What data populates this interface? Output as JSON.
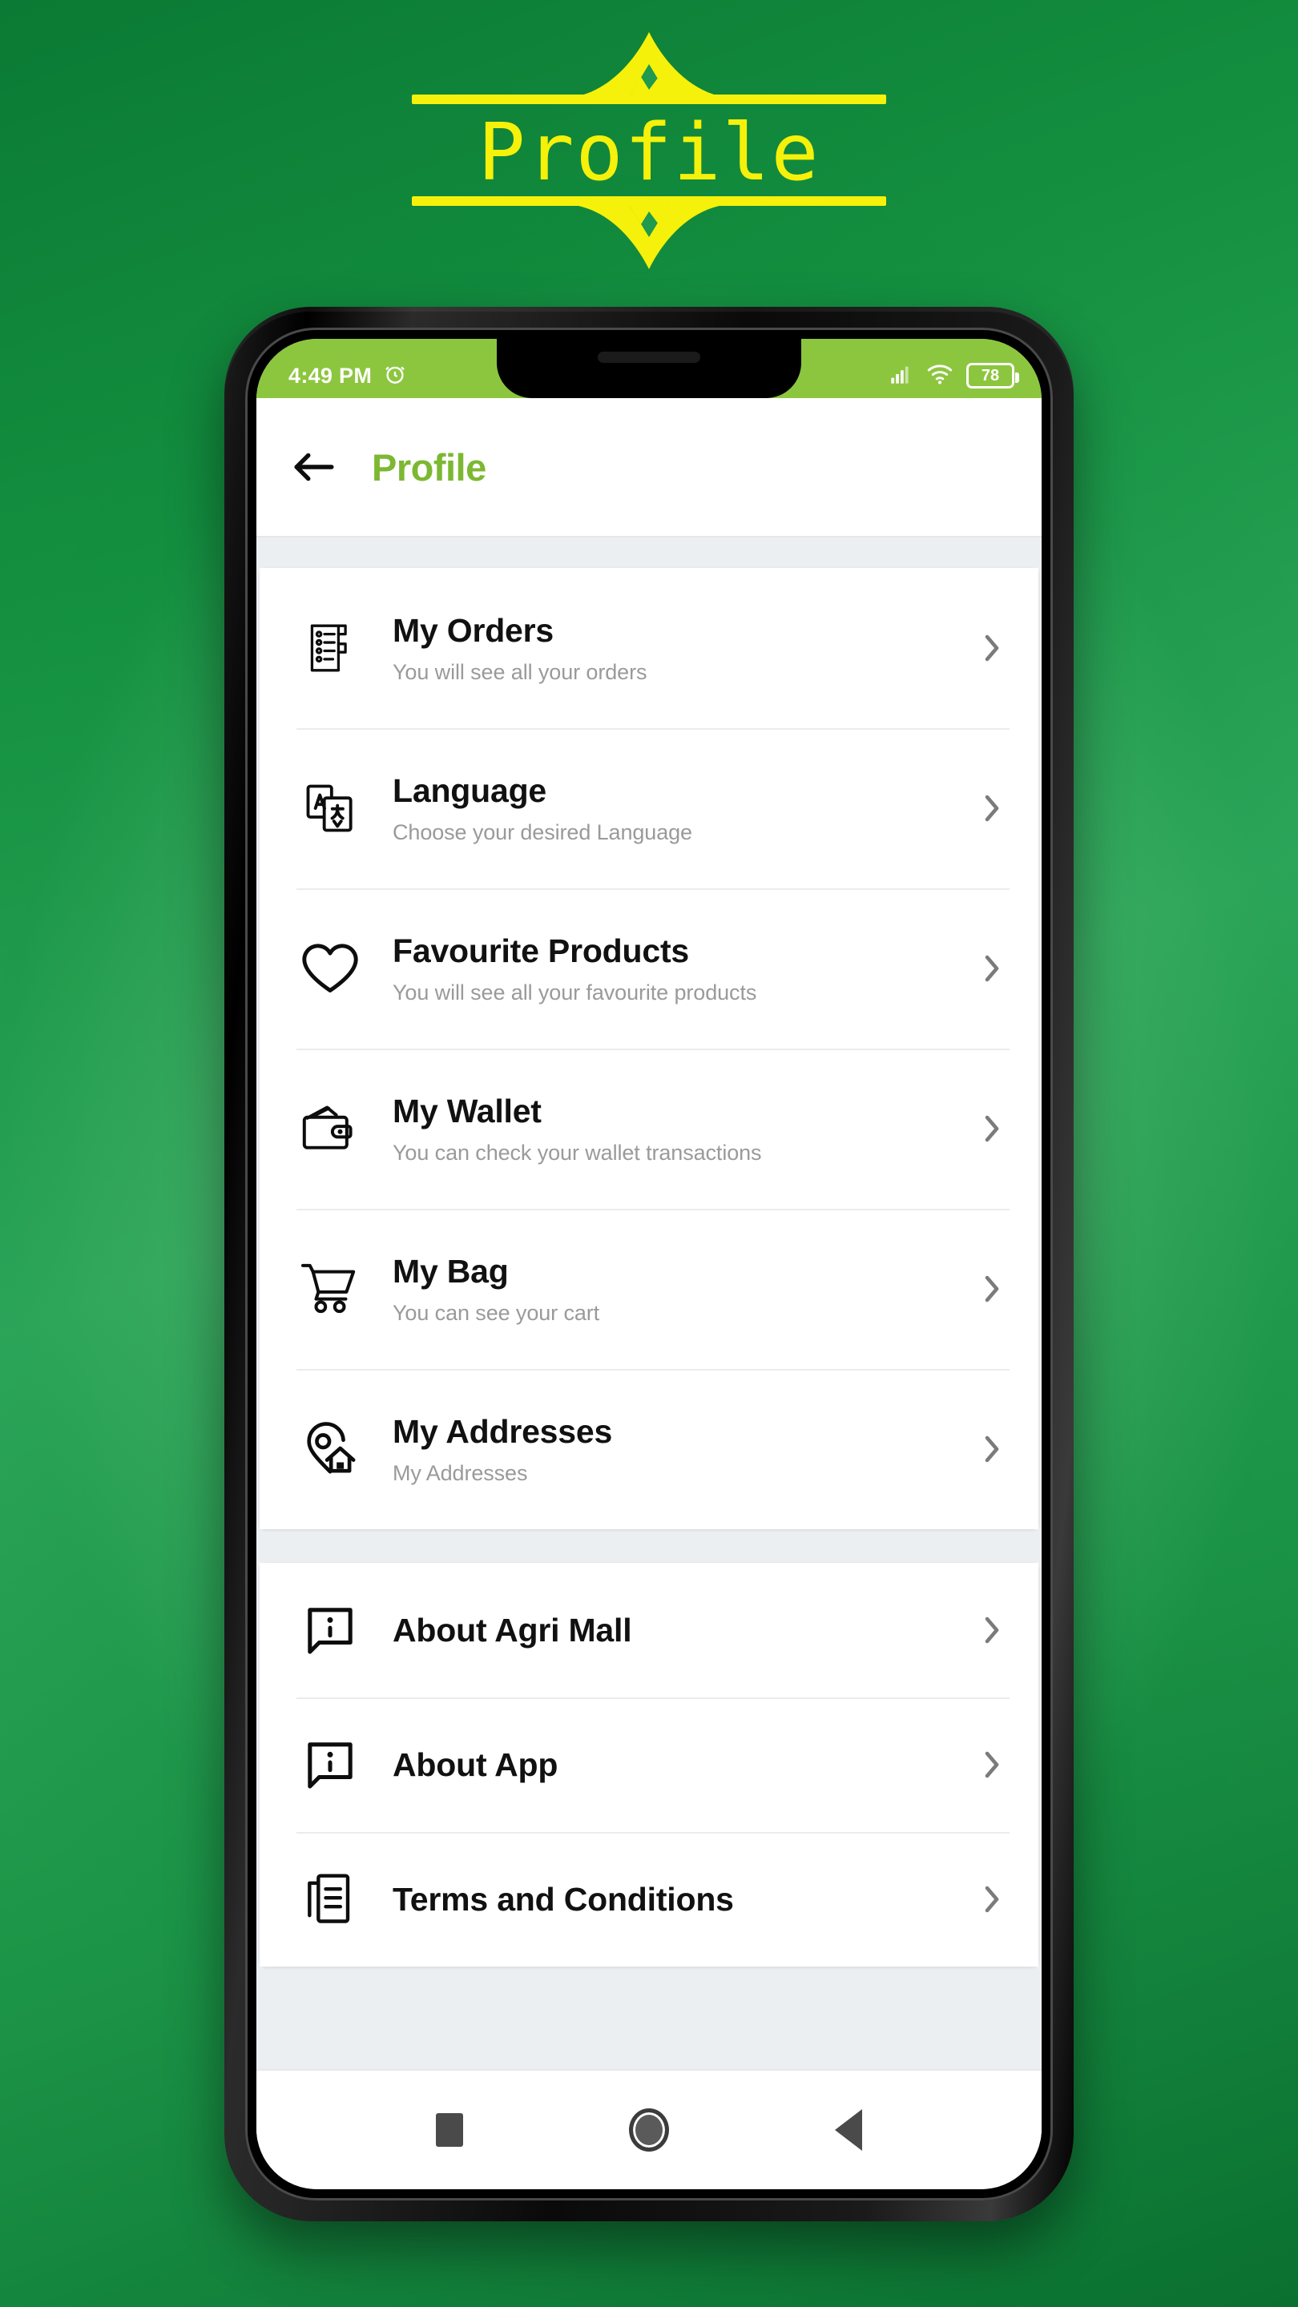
{
  "banner": {
    "title": "Profile",
    "accent_color": "#f5f10a",
    "background_color": "#1a9049"
  },
  "status_bar": {
    "time": "4:49 PM",
    "alarm_icon": "alarm-clock-icon",
    "signal_icon": "cellular-signal-icon",
    "wifi_icon": "wifi-icon",
    "battery_level": "78",
    "background_color": "#8cc63f"
  },
  "app_bar": {
    "back_icon": "back-arrow-icon",
    "title": "Profile",
    "title_color": "#7cb832"
  },
  "sections": [
    {
      "id": "account-section",
      "items": [
        {
          "icon": "orders-list-icon",
          "title": "My Orders",
          "subtitle": "You will see all your orders",
          "chevron": "chevron-right-icon"
        },
        {
          "icon": "translate-icon",
          "title": "Language",
          "subtitle": "Choose your desired Language",
          "chevron": "chevron-right-icon"
        },
        {
          "icon": "heart-icon",
          "title": "Favourite Products",
          "subtitle": "You will see all your favourite products",
          "chevron": "chevron-right-icon"
        },
        {
          "icon": "wallet-icon",
          "title": "My Wallet",
          "subtitle": "You can check your wallet transactions",
          "chevron": "chevron-right-icon"
        },
        {
          "icon": "shopping-cart-icon",
          "title": "My Bag",
          "subtitle": "You can see your cart",
          "chevron": "chevron-right-icon"
        },
        {
          "icon": "location-pin-home-icon",
          "title": "My Addresses",
          "subtitle": "My Addresses",
          "chevron": "chevron-right-icon"
        }
      ]
    },
    {
      "id": "info-section",
      "items": [
        {
          "icon": "info-bubble-icon",
          "title": "About Agri Mall",
          "subtitle": "",
          "chevron": "chevron-right-icon"
        },
        {
          "icon": "info-bubble-icon",
          "title": "About App",
          "subtitle": "",
          "chevron": "chevron-right-icon"
        },
        {
          "icon": "documents-icon",
          "title": "Terms and Conditions",
          "subtitle": "",
          "chevron": "chevron-right-icon"
        }
      ]
    }
  ],
  "nav_bar": {
    "recents_label": "recents-square-icon",
    "home_label": "home-circle-icon",
    "back_label": "back-triangle-icon"
  }
}
